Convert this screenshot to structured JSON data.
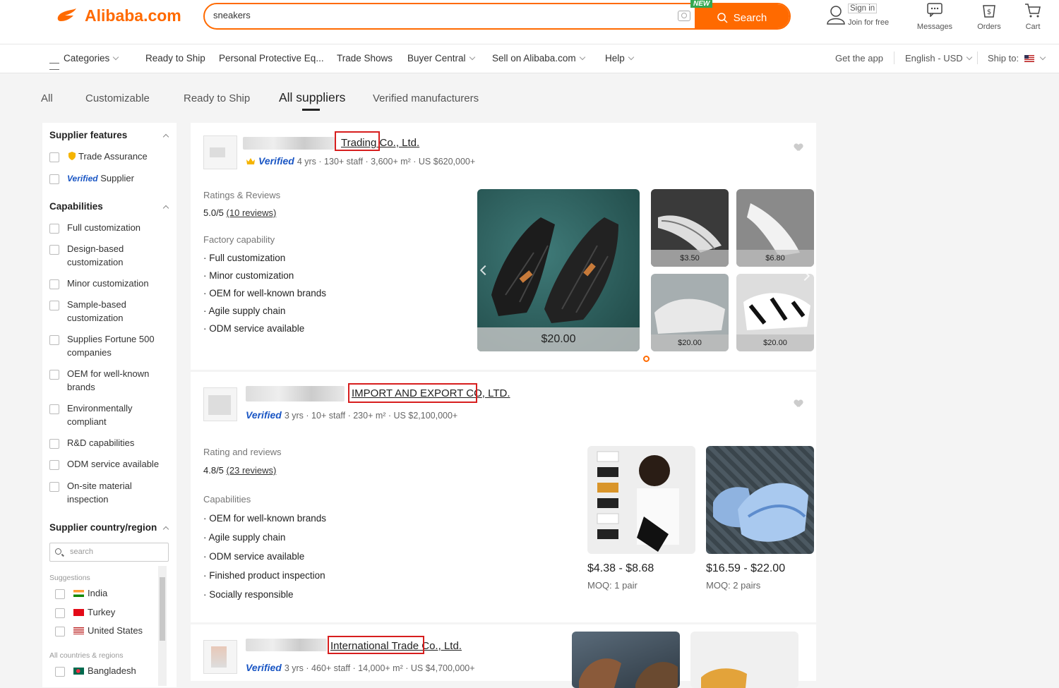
{
  "header": {
    "logo_text": "Alibaba.com",
    "search_value": "sneakers",
    "search_button": "Search",
    "new_tag": "NEW",
    "sign_in": "Sign in",
    "join": "Join for free",
    "messages": "Messages",
    "orders": "Orders",
    "cart": "Cart"
  },
  "nav": {
    "categories": "Categories",
    "items": [
      "Ready to Ship",
      "Personal Protective Eq...",
      "Trade Shows",
      "Buyer Central",
      "Sell on Alibaba.com",
      "Help"
    ],
    "get_app": "Get the app",
    "lang": "English - USD",
    "ship_to": "Ship to:"
  },
  "tabs": [
    "All",
    "Customizable",
    "Ready to Ship",
    "All suppliers",
    "Verified manufacturers"
  ],
  "sidebar": {
    "supplier_features": "Supplier features",
    "trade_assurance": "Trade Assurance",
    "verified_word": "Verified",
    "supplier_word": "Supplier",
    "capabilities": "Capabilities",
    "capability_options": [
      "Full customization",
      "Design-based customization",
      "Minor customization",
      "Sample-based customization",
      "Supplies Fortune 500 companies",
      "OEM for well-known brands",
      "Environmentally compliant",
      "R&D capabilities",
      "ODM service available",
      "On-site material inspection"
    ],
    "country_region": "Supplier country/region",
    "search_placeholder": "search",
    "suggestions": "Suggestions",
    "countries": [
      "India",
      "Turkey",
      "United States"
    ],
    "all_countries": "All countries & regions",
    "all_country_list": [
      "Bangladesh"
    ]
  },
  "cards": [
    {
      "name_highlight": "Trading",
      "name_rest": " Co., Ltd.",
      "verified": "Verified",
      "meta": "4 yrs · 130+ staff · 3,600+ m² · US $620,000+",
      "ratings_label": "Ratings & Reviews",
      "score": "5.0/5",
      "reviews": "(10 reviews)",
      "cap_label": "Factory capability",
      "caps": [
        "Full customization",
        "Minor customization",
        "OEM for well-known brands",
        "Agile supply chain",
        "ODM service available"
      ],
      "main_price": "$20.00",
      "thumb_prices": [
        "$3.50",
        "$6.80",
        "$20.00",
        "$20.00"
      ]
    },
    {
      "name_highlight": "IMPORT AND EXPORT CO",
      "name_rest": ", LTD.",
      "verified": "Verified",
      "meta": "3 yrs · 10+ staff · 230+ m² · US $2,100,000+",
      "ratings_label": "Rating and reviews",
      "score": "4.8/5",
      "reviews": "(23 reviews)",
      "cap_label": "Capabilities",
      "caps": [
        "OEM for well-known brands",
        "Agile supply chain",
        "ODM service available",
        "Finished product inspection",
        "Socially responsible"
      ],
      "products": [
        {
          "price": "$4.38 - $8.68",
          "moq": "MOQ: 1 pair"
        },
        {
          "price": "$16.59 - $22.00",
          "moq": "MOQ: 2 pairs"
        }
      ]
    },
    {
      "name_highlight": "International Trade",
      "name_rest": " Co., Ltd.",
      "verified": "Verified",
      "meta": "3 yrs · 460+ staff · 14,000+ m² · US $4,700,000+"
    }
  ],
  "colors": {
    "accent": "#ff6a00",
    "verified": "#1a56c4",
    "highlight_box": "#d71e1e"
  }
}
